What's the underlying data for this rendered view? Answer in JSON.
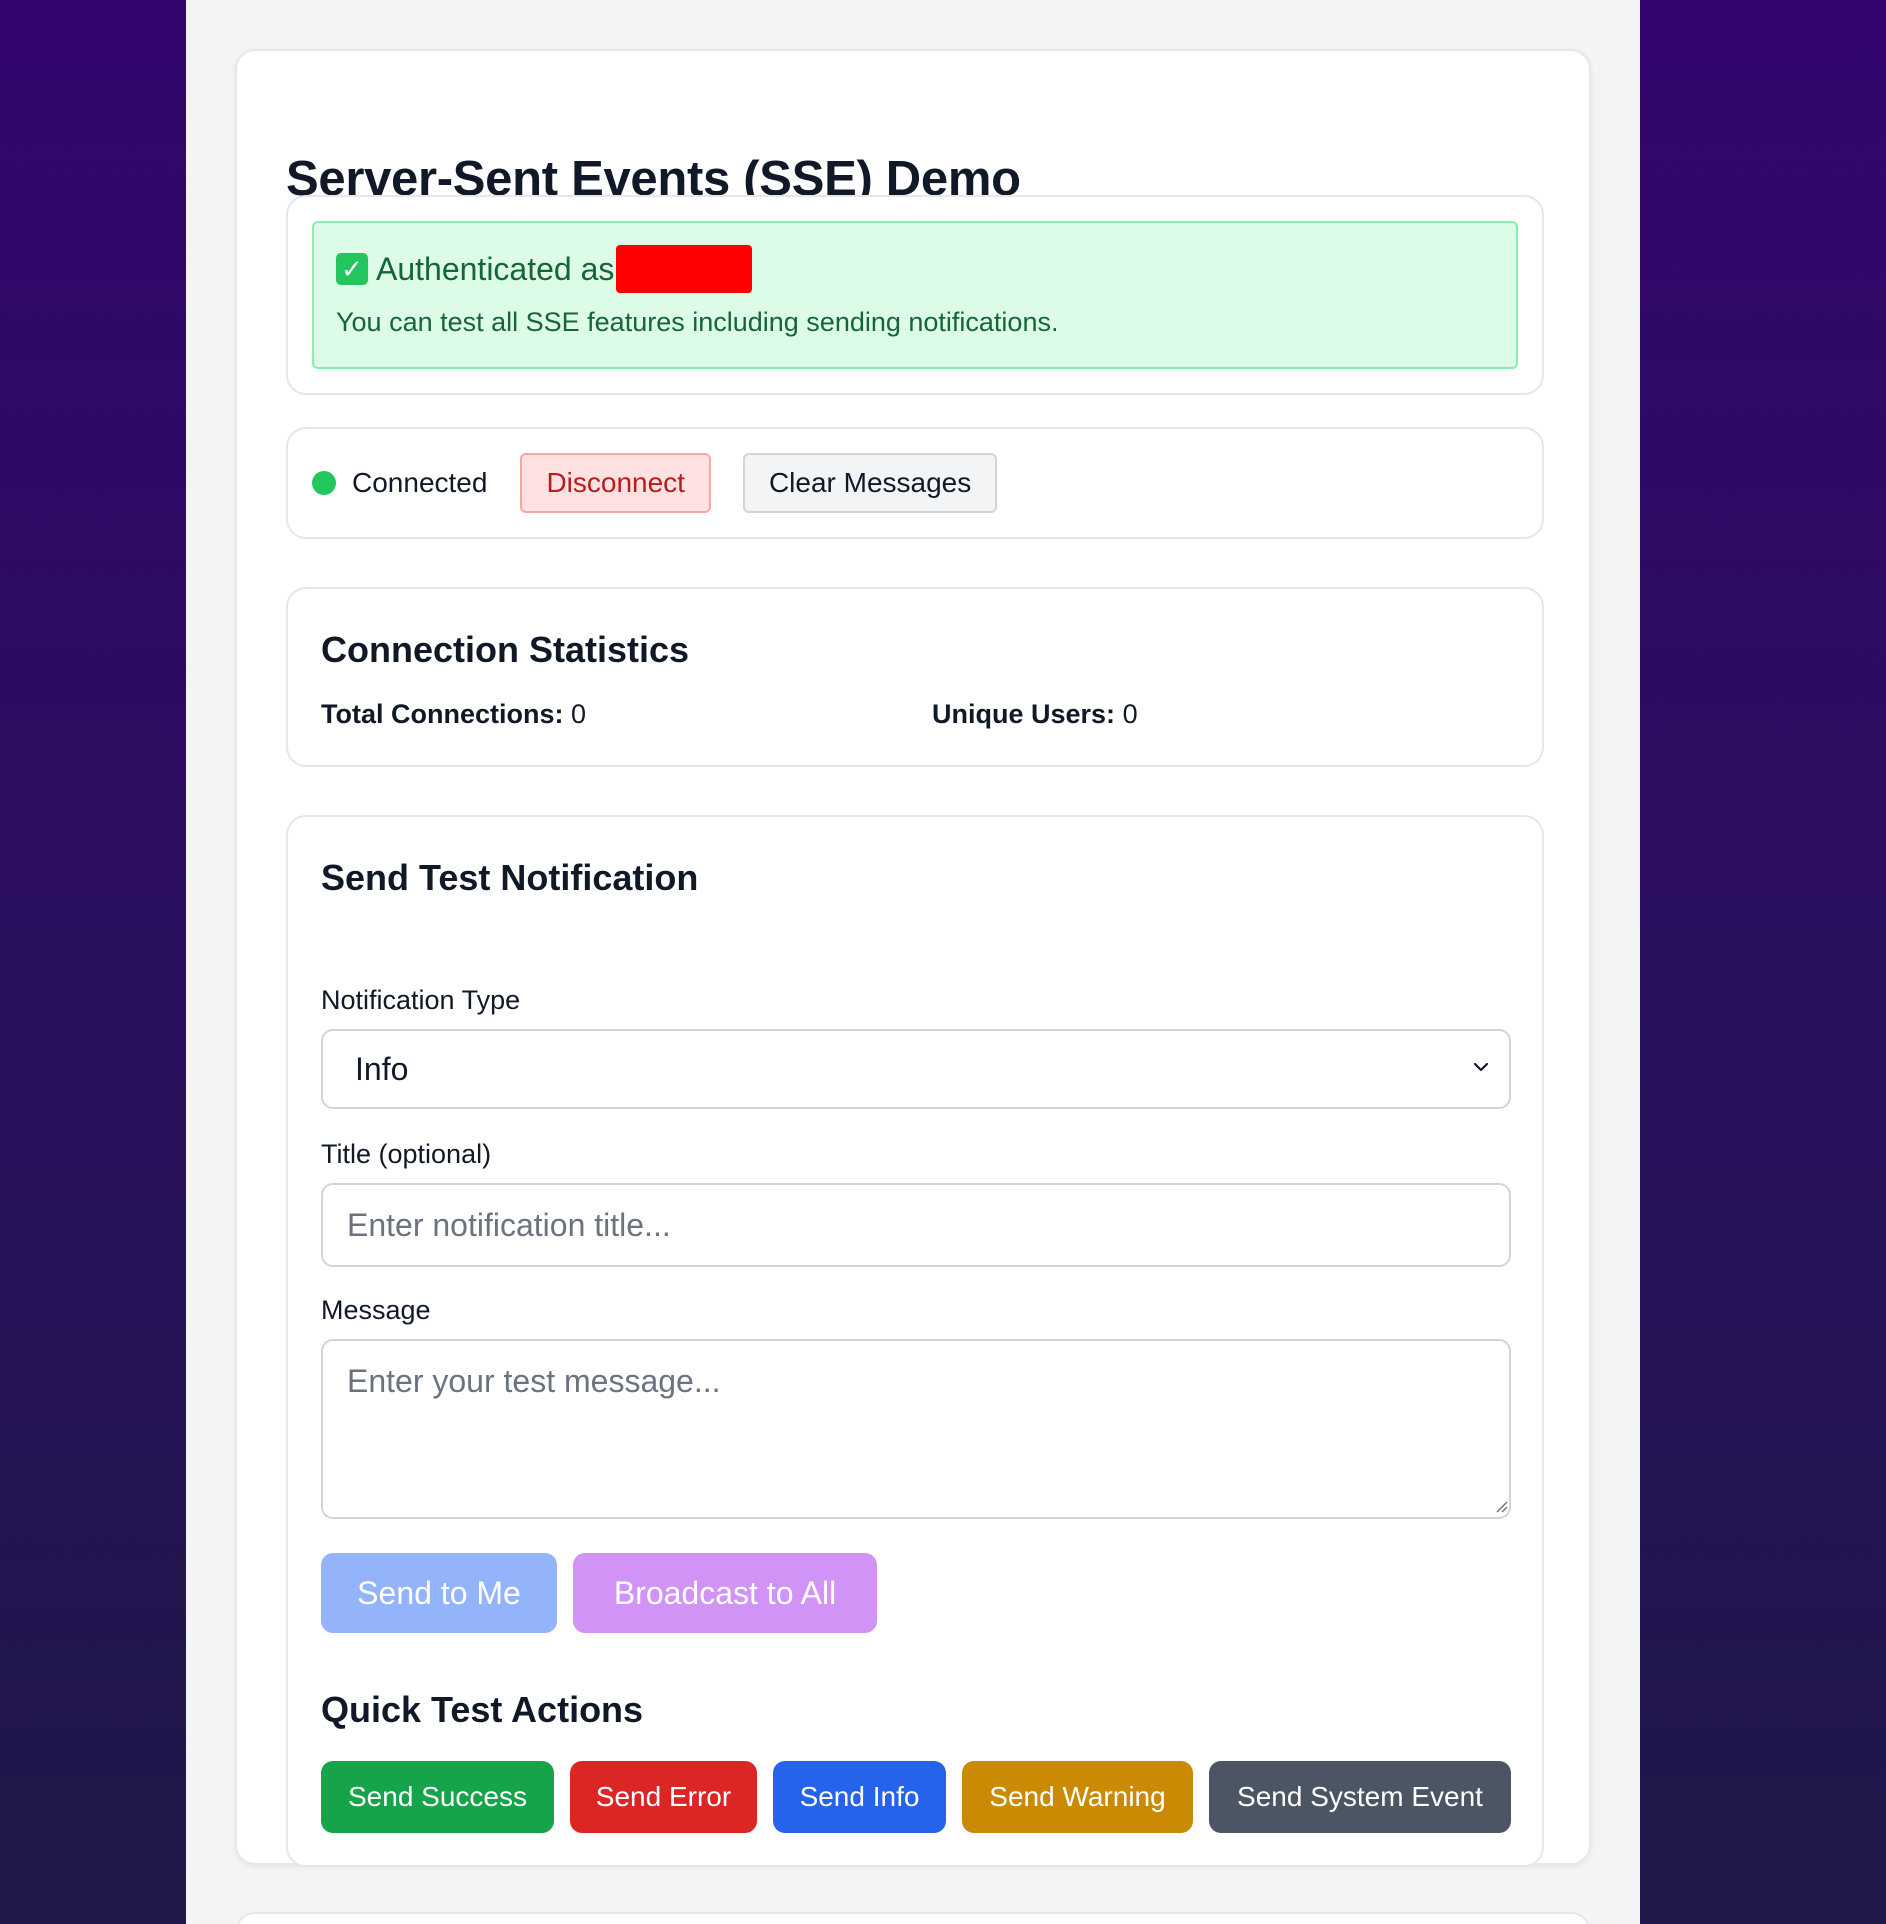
{
  "page": {
    "title": "Server-Sent Events (SSE) Demo"
  },
  "auth": {
    "prefix": "Authenticated as",
    "description": "You can test all SSE features including sending notifications.",
    "check_icon": "check-mark-icon",
    "redaction_color": "#ff0000"
  },
  "connection": {
    "status": "Connected",
    "status_color": "#22c55e",
    "disconnect_label": "Disconnect",
    "clear_label": "Clear Messages"
  },
  "stats": {
    "heading": "Connection Statistics",
    "total_label": "Total Connections:",
    "total_value": "0",
    "users_label": "Unique Users:",
    "users_value": "0"
  },
  "notification": {
    "heading": "Send Test Notification",
    "type_label": "Notification Type",
    "type_selected": "Info",
    "title_label": "Title (optional)",
    "title_placeholder": "Enter notification title...",
    "message_label": "Message",
    "message_placeholder": "Enter your test message...",
    "send_me_label": "Send to Me",
    "broadcast_label": "Broadcast to All"
  },
  "quick": {
    "heading": "Quick Test Actions",
    "buttons": [
      {
        "label": "Send Success",
        "color": "#16a34a"
      },
      {
        "label": "Send Error",
        "color": "#dc2626"
      },
      {
        "label": "Send Info",
        "color": "#2563eb"
      },
      {
        "label": "Send Warning",
        "color": "#ca8a04"
      },
      {
        "label": "Send System Event",
        "color": "#4b5563"
      }
    ]
  }
}
